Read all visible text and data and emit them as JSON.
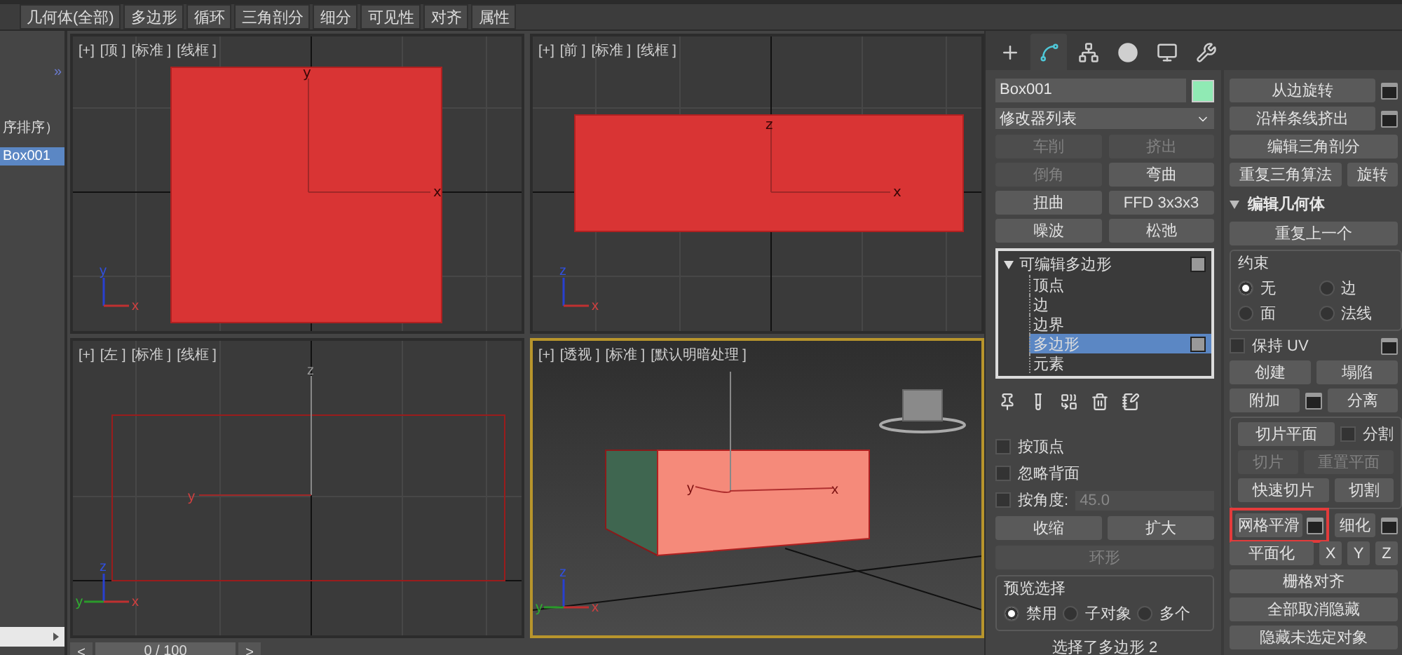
{
  "ribbon_tabs": [
    "几何体(全部)",
    "多边形",
    "循环",
    "三角剖分",
    "细分",
    "可见性",
    "对齐",
    "属性"
  ],
  "scene_explorer": {
    "toggle": "»",
    "items": [
      {
        "label": "序排序）",
        "selected": false
      },
      {
        "label": "Box001",
        "selected": true
      }
    ]
  },
  "viewports": [
    {
      "kind": "top",
      "active": false,
      "labels": [
        "[+]",
        "[顶 ]",
        "[标准 ]",
        "[线框 ]"
      ],
      "pivot_labels": [
        "y",
        "x"
      ],
      "tripod_labels": [
        "y",
        "x"
      ]
    },
    {
      "kind": "front",
      "active": false,
      "labels": [
        "[+]",
        "[前 ]",
        "[标准 ]",
        "[线框 ]"
      ],
      "pivot_labels": [
        "z",
        "x"
      ],
      "tripod_labels": [
        "z",
        "x"
      ]
    },
    {
      "kind": "left",
      "active": false,
      "labels": [
        "[+]",
        "[左 ]",
        "[标准 ]",
        "[线框 ]"
      ],
      "pivot_labels": [
        "z",
        "y"
      ],
      "tripod_labels": [
        "z",
        "y",
        "x"
      ]
    },
    {
      "kind": "perspective",
      "active": true,
      "labels": [
        "[+]",
        "[透视 ]",
        "[标准 ]",
        "[默认明暗处理 ]"
      ],
      "pivot_labels": [
        "y",
        "x"
      ],
      "tripod_labels": [
        "z",
        "y",
        "x"
      ]
    }
  ],
  "time_slider": {
    "prev": "<",
    "position": "0 / 100",
    "next": ">"
  },
  "command_tabs": [
    {
      "kind": "create",
      "selected": false
    },
    {
      "kind": "modify",
      "selected": true
    },
    {
      "kind": "hierarchy",
      "selected": false
    },
    {
      "kind": "motion",
      "selected": false
    },
    {
      "kind": "display",
      "selected": false
    },
    {
      "kind": "utilities",
      "selected": false
    }
  ],
  "object": {
    "name": "Box001",
    "color": "#90eab4"
  },
  "modifier_list": "修改器列表",
  "modifier_buttons": [
    {
      "label": "车削",
      "disabled": true
    },
    {
      "label": "挤出",
      "disabled": true
    },
    {
      "label": "倒角",
      "disabled": true
    },
    {
      "label": "弯曲",
      "disabled": false
    },
    {
      "label": "扭曲",
      "disabled": false
    },
    {
      "label": "FFD 3x3x3",
      "disabled": false
    },
    {
      "label": "噪波",
      "disabled": false
    },
    {
      "label": "松弛",
      "disabled": false
    }
  ],
  "modifier_stack": [
    {
      "label": "可编辑多边形",
      "expanded": true,
      "children": [
        {
          "label": "顶点",
          "selected": false
        },
        {
          "label": "边",
          "selected": false
        },
        {
          "label": "边界",
          "selected": false
        },
        {
          "label": "多边形",
          "selected": true
        },
        {
          "label": "元素",
          "selected": false
        }
      ]
    }
  ],
  "selection": {
    "options": [
      {
        "label": "按顶点",
        "checked": false
      },
      {
        "label": "忽略背面",
        "checked": false
      },
      {
        "label": "按角度:",
        "checked": false,
        "value": "45.0"
      }
    ],
    "buttons": [
      [
        {
          "label": "收缩",
          "disabled": false
        },
        {
          "label": "扩大",
          "disabled": false
        }
      ],
      [
        {
          "label": "环形",
          "disabled": true
        }
      ]
    ],
    "preview": {
      "title": "预览选择",
      "options": [
        {
          "label": "禁用",
          "selected": true
        },
        {
          "label": "子对象",
          "selected": false
        },
        {
          "label": "多个",
          "selected": false
        }
      ]
    },
    "status": "选择了多边形 2"
  },
  "edit_panel": [
    {
      "kind": "row",
      "items": [
        {
          "kind": "button",
          "label": "从边旋转",
          "settings": true
        }
      ]
    },
    {
      "kind": "row",
      "items": [
        {
          "kind": "button",
          "label": "沿样条线挤出",
          "settings": true
        }
      ]
    },
    {
      "kind": "row",
      "items": [
        {
          "kind": "button",
          "label": "编辑三角剖分"
        }
      ]
    },
    {
      "kind": "row",
      "items": [
        {
          "kind": "button",
          "label": "重复三角算法"
        },
        {
          "kind": "button",
          "label": "旋转"
        }
      ]
    },
    {
      "kind": "rollout",
      "title": "编辑几何体",
      "expanded": true
    },
    {
      "kind": "row",
      "items": [
        {
          "kind": "button",
          "label": "重复上一个"
        }
      ]
    },
    {
      "kind": "group",
      "title": "约束",
      "rows": [
        [
          {
            "kind": "radio",
            "label": "无",
            "selected": true
          },
          {
            "kind": "radio",
            "label": "边",
            "selected": false
          }
        ],
        [
          {
            "kind": "radio",
            "label": "面",
            "selected": false
          },
          {
            "kind": "radio",
            "label": "法线",
            "selected": false
          }
        ]
      ]
    },
    {
      "kind": "row",
      "items": [
        {
          "kind": "checkbox",
          "label": "保持 UV",
          "checked": false,
          "settings": true
        }
      ]
    },
    {
      "kind": "row",
      "items": [
        {
          "kind": "button",
          "label": "创建"
        },
        {
          "kind": "button",
          "label": "塌陷"
        }
      ]
    },
    {
      "kind": "row",
      "items": [
        {
          "kind": "button",
          "label": "附加",
          "settings": true
        },
        {
          "kind": "button",
          "label": "分离"
        }
      ]
    },
    {
      "kind": "group",
      "rows": [
        [
          {
            "kind": "button",
            "label": "切片平面"
          },
          {
            "kind": "checkbox",
            "label": "分割",
            "checked": false
          }
        ],
        [
          {
            "kind": "button",
            "label": "切片",
            "disabled": true
          },
          {
            "kind": "button",
            "label": "重置平面",
            "disabled": true
          }
        ],
        [
          {
            "kind": "button",
            "label": "快速切片"
          },
          {
            "kind": "button",
            "label": "切割"
          }
        ]
      ]
    },
    {
      "kind": "row",
      "items": [
        {
          "kind": "button",
          "label": "网格平滑",
          "settings": true,
          "highlighted": true
        },
        {
          "kind": "button",
          "label": "细化",
          "settings": true
        }
      ]
    },
    {
      "kind": "row",
      "items": [
        {
          "kind": "button",
          "label": "平面化"
        },
        {
          "kind": "axis",
          "label": "X"
        },
        {
          "kind": "axis",
          "label": "Y"
        },
        {
          "kind": "axis",
          "label": "Z"
        }
      ]
    },
    {
      "kind": "row",
      "items": [
        {
          "kind": "button",
          "label": "栅格对齐"
        }
      ]
    },
    {
      "kind": "row",
      "items": [
        {
          "kind": "button",
          "label": "全部取消隐藏"
        }
      ]
    },
    {
      "kind": "row",
      "items": [
        {
          "kind": "button",
          "label": "隐藏未选定对象"
        }
      ]
    }
  ]
}
